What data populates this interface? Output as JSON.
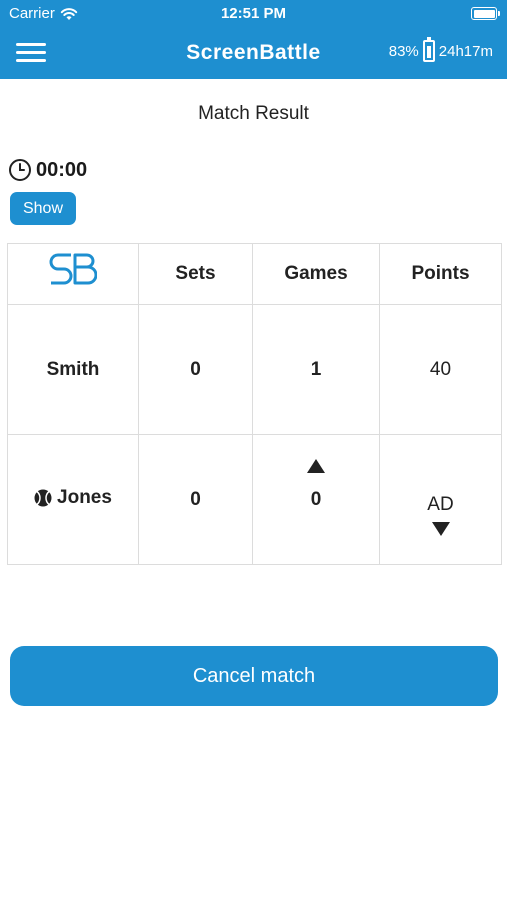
{
  "status_bar": {
    "carrier": "Carrier",
    "time": "12:51 PM"
  },
  "nav": {
    "title": "ScreenBattle",
    "battery_percent": "83%",
    "battery_time": "24h17m"
  },
  "page": {
    "heading": "Match Result"
  },
  "timer": {
    "value": "00:00",
    "show_label": "Show"
  },
  "scoreboard": {
    "logo_text": "SB",
    "headers": {
      "sets": "Sets",
      "games": "Games",
      "points": "Points"
    },
    "rows": [
      {
        "name": "Smith",
        "sets": "0",
        "games": "1",
        "points": "40",
        "serving": false
      },
      {
        "name": "Jones",
        "sets": "0",
        "games": "0",
        "points": "AD",
        "serving": true
      }
    ]
  },
  "actions": {
    "cancel_label": "Cancel match"
  },
  "colors": {
    "accent": "#1e8fd0"
  }
}
